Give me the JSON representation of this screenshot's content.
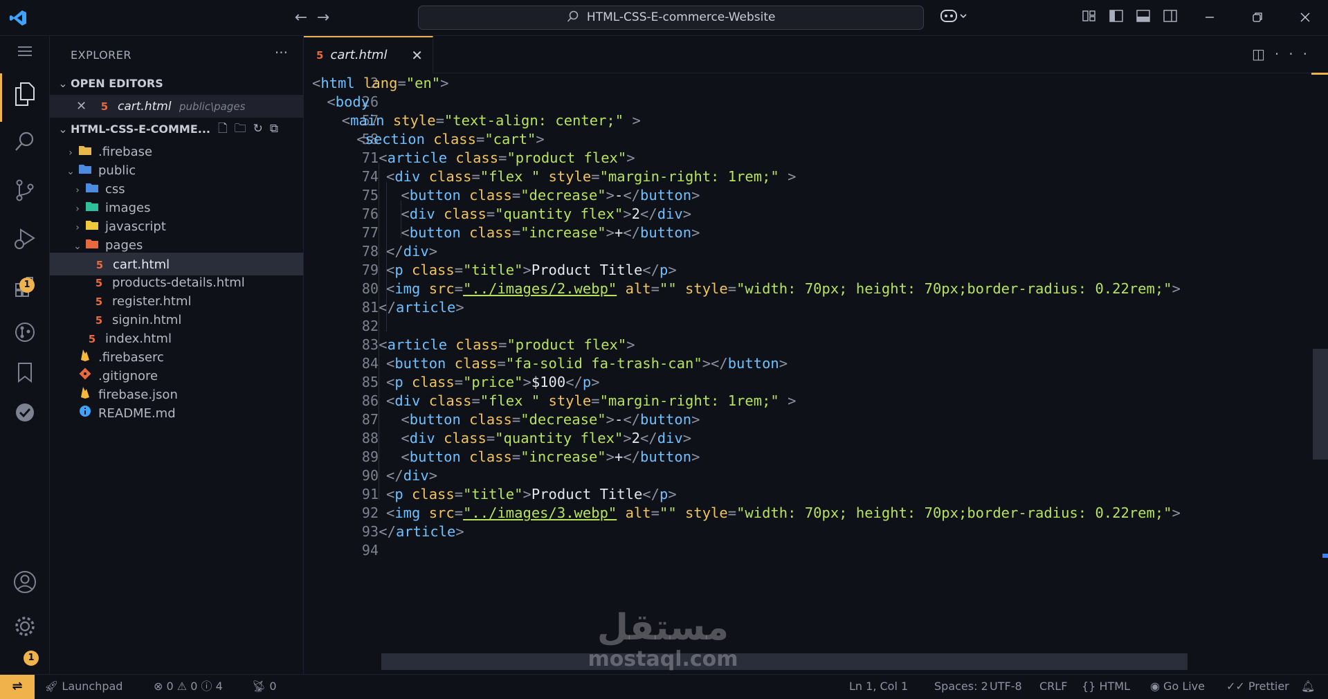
{
  "titlebar": {
    "search_text": "HTML-CSS-E-commerce-Website",
    "back_glyph": "←",
    "forward_glyph": "→"
  },
  "activity_bar": {
    "extensions_badge": "1",
    "settings_badge": "1"
  },
  "sidebar": {
    "title": "EXPLORER",
    "open_editors_label": "OPEN EDITORS",
    "open_editor": {
      "name": "cart.html",
      "path": "public\\pages"
    },
    "project_label": "HTML-CSS-E-COMME...",
    "tree": [
      {
        "name": ".firebase",
        "type": "folder",
        "icon": "folder-icon",
        "color": "#e9b84a"
      },
      {
        "name": "public",
        "type": "folder-open",
        "icon": "globe-folder-icon",
        "color": "#4b8be0"
      },
      {
        "name": "css",
        "type": "folder",
        "icon": "css-folder-icon",
        "color": "#4b8be0"
      },
      {
        "name": "images",
        "type": "folder",
        "icon": "images-folder-icon",
        "color": "#2ebf9b"
      },
      {
        "name": "javascript",
        "type": "folder",
        "icon": "folder-icon",
        "color": "#f0c93a"
      },
      {
        "name": "pages",
        "type": "folder-open",
        "icon": "pages-folder-icon",
        "color": "#e8693d"
      },
      {
        "name": "cart.html",
        "type": "file",
        "icon": "html5-icon"
      },
      {
        "name": "products-details.html",
        "type": "file",
        "icon": "html5-icon"
      },
      {
        "name": "register.html",
        "type": "file",
        "icon": "html5-icon"
      },
      {
        "name": "signin.html",
        "type": "file",
        "icon": "html5-icon"
      },
      {
        "name": "index.html",
        "type": "file",
        "icon": "html5-icon"
      },
      {
        "name": ".firebaserc",
        "type": "file",
        "icon": "firebase-icon"
      },
      {
        "name": ".gitignore",
        "type": "file",
        "icon": "git-icon"
      },
      {
        "name": "firebase.json",
        "type": "file",
        "icon": "firebase-icon"
      },
      {
        "name": "README.md",
        "type": "file",
        "icon": "info-icon"
      }
    ]
  },
  "editor": {
    "tab_label": "cart.html",
    "lines": [
      {
        "num": "2",
        "indent": 0,
        "tokens": [
          [
            "br",
            "<"
          ],
          [
            "tag",
            "html"
          ],
          [
            "attr",
            " lang"
          ],
          [
            "br",
            "="
          ],
          [
            "str",
            "\"en\""
          ],
          [
            "br",
            ">"
          ]
        ]
      },
      {
        "num": "26",
        "indent": 2,
        "tokens": [
          [
            "br",
            "<"
          ],
          [
            "tag",
            "body"
          ]
        ]
      },
      {
        "num": "57",
        "indent": 4,
        "tokens": [
          [
            "br",
            "<"
          ],
          [
            "tag",
            "main"
          ],
          [
            "attr",
            " style"
          ],
          [
            "br",
            "="
          ],
          [
            "str",
            "\"text-align: center;\""
          ],
          [
            "br",
            " >"
          ]
        ]
      },
      {
        "num": "58",
        "indent": 6,
        "tokens": [
          [
            "br",
            "<"
          ],
          [
            "tag",
            "section"
          ],
          [
            "attr",
            " class"
          ],
          [
            "br",
            "="
          ],
          [
            "str",
            "\"cart\""
          ],
          [
            "br",
            ">"
          ]
        ]
      },
      {
        "num": "71",
        "indent": 9,
        "tokens": [
          [
            "br",
            "<"
          ],
          [
            "tag",
            "article"
          ],
          [
            "attr",
            " class"
          ],
          [
            "br",
            "="
          ],
          [
            "str",
            "\"product flex\""
          ],
          [
            "br",
            ">"
          ]
        ]
      },
      {
        "num": "74",
        "indent": 10,
        "tokens": [
          [
            "br",
            "<"
          ],
          [
            "tag",
            "div"
          ],
          [
            "attr",
            " class"
          ],
          [
            "br",
            "="
          ],
          [
            "str",
            "\"flex \""
          ],
          [
            "attr",
            " style"
          ],
          [
            "br",
            "="
          ],
          [
            "str",
            "\"margin-right: 1rem;\""
          ],
          [
            "br",
            " >"
          ]
        ]
      },
      {
        "num": "75",
        "indent": 12,
        "tokens": [
          [
            "br",
            "<"
          ],
          [
            "tag",
            "button"
          ],
          [
            "attr",
            " class"
          ],
          [
            "br",
            "="
          ],
          [
            "str",
            "\"decrease\""
          ],
          [
            "br",
            ">"
          ],
          [
            "txt",
            "-"
          ],
          [
            "br",
            "</"
          ],
          [
            "tag",
            "button"
          ],
          [
            "br",
            ">"
          ]
        ]
      },
      {
        "num": "76",
        "indent": 12,
        "tokens": [
          [
            "br",
            "<"
          ],
          [
            "tag",
            "div"
          ],
          [
            "attr",
            " class"
          ],
          [
            "br",
            "="
          ],
          [
            "str",
            "\"quantity flex\""
          ],
          [
            "br",
            ">"
          ],
          [
            "txt",
            "2"
          ],
          [
            "br",
            "</"
          ],
          [
            "tag",
            "div"
          ],
          [
            "br",
            ">"
          ]
        ]
      },
      {
        "num": "77",
        "indent": 12,
        "tokens": [
          [
            "br",
            "<"
          ],
          [
            "tag",
            "button"
          ],
          [
            "attr",
            " class"
          ],
          [
            "br",
            "="
          ],
          [
            "str",
            "\"increase\""
          ],
          [
            "br",
            ">"
          ],
          [
            "txt",
            "+"
          ],
          [
            "br",
            "</"
          ],
          [
            "tag",
            "button"
          ],
          [
            "br",
            ">"
          ]
        ]
      },
      {
        "num": "78",
        "indent": 10,
        "tokens": [
          [
            "br",
            "</"
          ],
          [
            "tag",
            "div"
          ],
          [
            "br",
            ">"
          ]
        ]
      },
      {
        "num": "79",
        "indent": 10,
        "tokens": [
          [
            "br",
            "<"
          ],
          [
            "tag",
            "p"
          ],
          [
            "attr",
            " class"
          ],
          [
            "br",
            "="
          ],
          [
            "str",
            "\"title\""
          ],
          [
            "br",
            ">"
          ],
          [
            "txt",
            "Product Title"
          ],
          [
            "br",
            "</"
          ],
          [
            "tag",
            "p"
          ],
          [
            "br",
            ">"
          ]
        ]
      },
      {
        "num": "80",
        "indent": 10,
        "tokens": [
          [
            "br",
            "<"
          ],
          [
            "tag",
            "img"
          ],
          [
            "attr",
            " src"
          ],
          [
            "br",
            "="
          ],
          [
            "strlink",
            "\"../images/2.webp\""
          ],
          [
            "attr",
            " alt"
          ],
          [
            "br",
            "="
          ],
          [
            "str",
            "\"\""
          ],
          [
            "attr",
            " style"
          ],
          [
            "br",
            "="
          ],
          [
            "str",
            "\"width: 70px; height: 70px;border-radius: 0.22rem;\""
          ],
          [
            "br",
            ">"
          ]
        ]
      },
      {
        "num": "81",
        "indent": 9,
        "tokens": [
          [
            "br",
            "</"
          ],
          [
            "tag",
            "article"
          ],
          [
            "br",
            ">"
          ]
        ]
      },
      {
        "num": "82",
        "indent": 0,
        "tokens": []
      },
      {
        "num": "83",
        "indent": 9,
        "tokens": [
          [
            "br",
            "<"
          ],
          [
            "tag",
            "article"
          ],
          [
            "attr",
            " class"
          ],
          [
            "br",
            "="
          ],
          [
            "str",
            "\"product flex\""
          ],
          [
            "br",
            ">"
          ]
        ]
      },
      {
        "num": "84",
        "indent": 10,
        "tokens": [
          [
            "br",
            "<"
          ],
          [
            "tag",
            "button"
          ],
          [
            "attr",
            " class"
          ],
          [
            "br",
            "="
          ],
          [
            "str",
            "\"fa-solid fa-trash-can\""
          ],
          [
            "br",
            "></"
          ],
          [
            "tag",
            "button"
          ],
          [
            "br",
            ">"
          ]
        ]
      },
      {
        "num": "85",
        "indent": 10,
        "tokens": [
          [
            "br",
            "<"
          ],
          [
            "tag",
            "p"
          ],
          [
            "attr",
            " class"
          ],
          [
            "br",
            "="
          ],
          [
            "str",
            "\"price\""
          ],
          [
            "br",
            ">"
          ],
          [
            "txt",
            "$100"
          ],
          [
            "br",
            "</"
          ],
          [
            "tag",
            "p"
          ],
          [
            "br",
            ">"
          ]
        ]
      },
      {
        "num": "86",
        "indent": 10,
        "tokens": [
          [
            "br",
            "<"
          ],
          [
            "tag",
            "div"
          ],
          [
            "attr",
            " class"
          ],
          [
            "br",
            "="
          ],
          [
            "str",
            "\"flex \""
          ],
          [
            "attr",
            " style"
          ],
          [
            "br",
            "="
          ],
          [
            "str",
            "\"margin-right: 1rem;\""
          ],
          [
            "br",
            " >"
          ]
        ]
      },
      {
        "num": "87",
        "indent": 12,
        "tokens": [
          [
            "br",
            "<"
          ],
          [
            "tag",
            "button"
          ],
          [
            "attr",
            " class"
          ],
          [
            "br",
            "="
          ],
          [
            "str",
            "\"decrease\""
          ],
          [
            "br",
            ">"
          ],
          [
            "txt",
            "-"
          ],
          [
            "br",
            "</"
          ],
          [
            "tag",
            "button"
          ],
          [
            "br",
            ">"
          ]
        ]
      },
      {
        "num": "88",
        "indent": 12,
        "tokens": [
          [
            "br",
            "<"
          ],
          [
            "tag",
            "div"
          ],
          [
            "attr",
            " class"
          ],
          [
            "br",
            "="
          ],
          [
            "str",
            "\"quantity flex\""
          ],
          [
            "br",
            ">"
          ],
          [
            "txt",
            "2"
          ],
          [
            "br",
            "</"
          ],
          [
            "tag",
            "div"
          ],
          [
            "br",
            ">"
          ]
        ]
      },
      {
        "num": "89",
        "indent": 12,
        "tokens": [
          [
            "br",
            "<"
          ],
          [
            "tag",
            "button"
          ],
          [
            "attr",
            " class"
          ],
          [
            "br",
            "="
          ],
          [
            "str",
            "\"increase\""
          ],
          [
            "br",
            ">"
          ],
          [
            "txt",
            "+"
          ],
          [
            "br",
            "</"
          ],
          [
            "tag",
            "button"
          ],
          [
            "br",
            ">"
          ]
        ]
      },
      {
        "num": "90",
        "indent": 10,
        "tokens": [
          [
            "br",
            "</"
          ],
          [
            "tag",
            "div"
          ],
          [
            "br",
            ">"
          ]
        ]
      },
      {
        "num": "91",
        "indent": 10,
        "tokens": [
          [
            "br",
            "<"
          ],
          [
            "tag",
            "p"
          ],
          [
            "attr",
            " class"
          ],
          [
            "br",
            "="
          ],
          [
            "str",
            "\"title\""
          ],
          [
            "br",
            ">"
          ],
          [
            "txt",
            "Product Title"
          ],
          [
            "br",
            "</"
          ],
          [
            "tag",
            "p"
          ],
          [
            "br",
            ">"
          ]
        ]
      },
      {
        "num": "92",
        "indent": 10,
        "tokens": [
          [
            "br",
            "<"
          ],
          [
            "tag",
            "img"
          ],
          [
            "attr",
            " src"
          ],
          [
            "br",
            "="
          ],
          [
            "strlink",
            "\"../images/3.webp\""
          ],
          [
            "attr",
            " alt"
          ],
          [
            "br",
            "="
          ],
          [
            "str",
            "\"\""
          ],
          [
            "attr",
            " style"
          ],
          [
            "br",
            "="
          ],
          [
            "str",
            "\"width: 70px; height: 70px;border-radius: 0.22rem;\""
          ],
          [
            "br",
            ">"
          ]
        ]
      },
      {
        "num": "93",
        "indent": 9,
        "tokens": [
          [
            "br",
            "</"
          ],
          [
            "tag",
            "article"
          ],
          [
            "br",
            ">"
          ]
        ]
      },
      {
        "num": "94",
        "indent": 0,
        "tokens": []
      }
    ]
  },
  "watermark": {
    "arabic": "مستقل",
    "latin": "mostaql.com"
  },
  "statusbar": {
    "launchpad": "Launchpad",
    "errors": "0",
    "warnings": "0",
    "infos": "4",
    "ports": "0",
    "cursor": "Ln 1, Col 1",
    "spaces": "Spaces: 2",
    "encoding": "UTF-8",
    "eol": "CRLF",
    "language": "HTML",
    "golive": "Go Live",
    "prettier": "Prettier"
  },
  "colors": {
    "accent": "#f0b24b",
    "tag": "#6ec0ff",
    "attr": "#f2c45c",
    "string": "#b8e35c",
    "html_icon": "#e8693d"
  }
}
